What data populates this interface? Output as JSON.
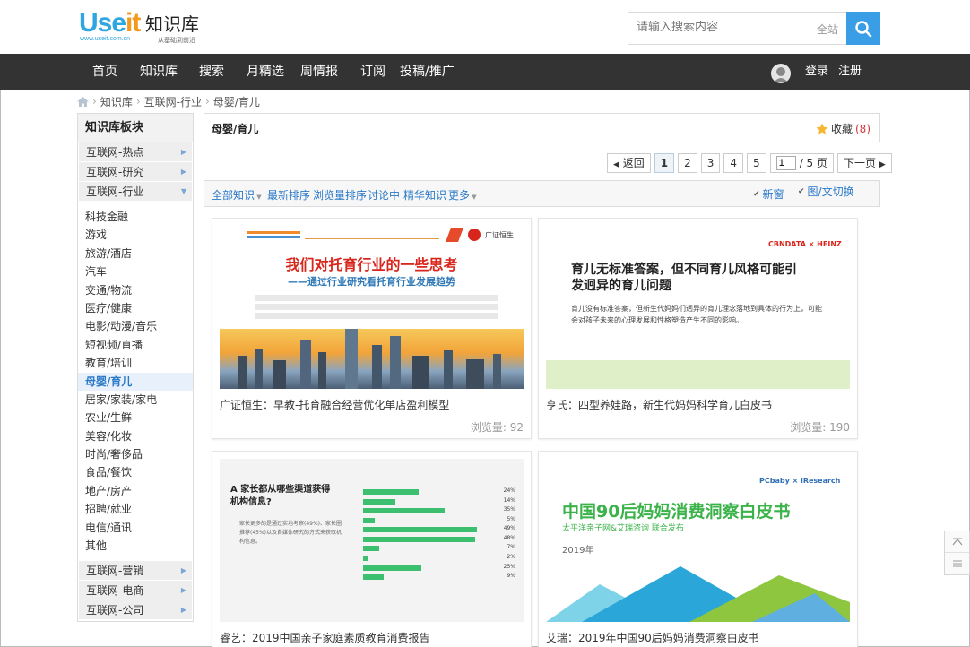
{
  "header": {
    "logo_mark": "Useit",
    "logo_url": "www.useit.com.cn",
    "site_name": "知识库",
    "slogan": "从基础到前沿",
    "search_placeholder": "请输入搜索内容",
    "search_scope": "全站"
  },
  "nav": {
    "items": [
      "首页",
      "知识库",
      "搜索",
      "月精选",
      "周情报",
      "订阅",
      "投稿/推广"
    ],
    "login": "登录",
    "register": "注册"
  },
  "breadcrumb": [
    "知识库",
    "互联网-行业",
    "母婴/育儿"
  ],
  "sidebar": {
    "title": "知识库板块",
    "categories_top": [
      "互联网-热点",
      "互联网-研究",
      "互联网-行业"
    ],
    "subitems": [
      "科技金融",
      "游戏",
      "旅游/酒店",
      "汽车",
      "交通/物流",
      "医疗/健康",
      "电影/动漫/音乐",
      "短视频/直播",
      "教育/培训",
      "母婴/育儿",
      "居家/家装/家电",
      "农业/生鲜",
      "美容/化妆",
      "时尚/奢侈品",
      "食品/餐饮",
      "地产/房产",
      "招聘/就业",
      "电信/通讯",
      "其他"
    ],
    "active_sub": "母婴/育儿",
    "categories_bottom": [
      "互联网-营销",
      "互联网-电商",
      "互联网-公司"
    ]
  },
  "main": {
    "title": "母婴/育儿",
    "favorite_label": "收藏",
    "favorite_count": "(8)"
  },
  "pager": {
    "prev": "返回",
    "pages": [
      "1",
      "2",
      "3",
      "4",
      "5"
    ],
    "current": "1",
    "input_value": "1",
    "total": "/ 5 页",
    "next": "下一页"
  },
  "toolbar": {
    "all": "全部知识",
    "latest": "最新排序",
    "views": "浏览量排序",
    "discussing": "讨论中",
    "featured": "精华知识",
    "more": "更多",
    "new_window": "新窗",
    "toggle": "图/文切换"
  },
  "cards": [
    {
      "title": "广证恒生：早教-托育融合经营优化单店盈利模型",
      "views": "浏览量: 92",
      "thumb_big": "我们对托育行业的一些思考",
      "thumb_sub": "——通过行业研究看托育行业发展趋势",
      "thumb_brand": "广证恒生"
    },
    {
      "title": "亨氏：四型养娃路，新生代妈妈科学育儿白皮书",
      "views": "浏览量: 190",
      "thumb_big": "育儿无标准答案，但不同育儿风格可能引发迥异的育儿问题",
      "thumb_text": "育儿没有标准答案，但新生代妈妈们迥异的育儿理念落地到具体的行为上，可能会对孩子未来的心理发展和性格塑造产生不同的影响。",
      "thumb_brand": "CBNDATA × HEINZ"
    },
    {
      "title": "睿艺：2019中国亲子家庭素质教育消费报告",
      "views": "",
      "thumb_title": "A 家长都从哪些渠道获得机构信息?",
      "thumb_text": "家长更多的是通过实地考察(49%)、家长圈推荐(45%)以及自媒体研究的方式来获取机构信息。",
      "bars": [
        {
          "label": "24%",
          "value": 24
        },
        {
          "label": "14%",
          "value": 14
        },
        {
          "label": "35%",
          "value": 35
        },
        {
          "label": "5%",
          "value": 5
        },
        {
          "label": "49%",
          "value": 49
        },
        {
          "label": "48%",
          "value": 48
        },
        {
          "label": "7%",
          "value": 7
        },
        {
          "label": "2%",
          "value": 2
        },
        {
          "label": "25%",
          "value": 25
        },
        {
          "label": "9%",
          "value": 9
        }
      ]
    },
    {
      "title": "艾瑞：2019年中国90后妈妈消费洞察白皮书",
      "views": "",
      "thumb_big": "中国90后妈妈消费洞察白皮书",
      "thumb_sub": "太平洋亲子网&艾瑞咨询 联合发布",
      "thumb_year": "2019年",
      "thumb_brand": "PCbaby × iResearch"
    }
  ],
  "colors": {
    "accent": "#3a9ee6",
    "nav_bg": "#333333",
    "link": "#2a79c8",
    "count_red": "#d0393a"
  }
}
